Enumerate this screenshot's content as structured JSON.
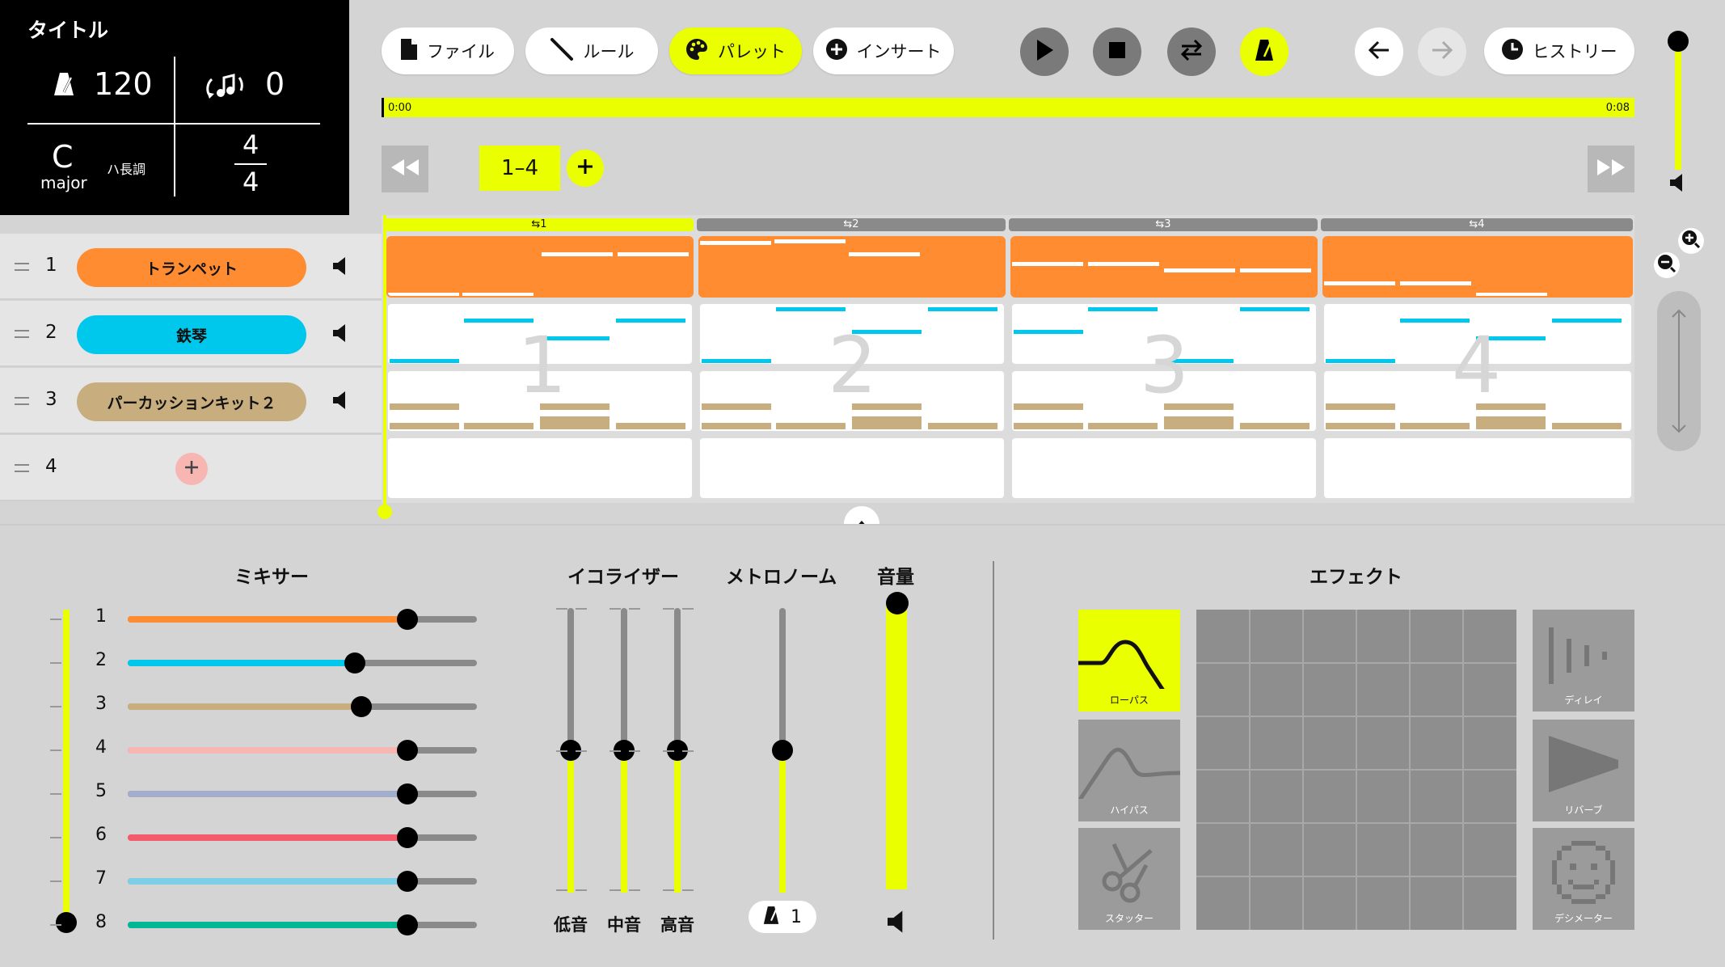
{
  "info": {
    "title": "タイトル",
    "tempo": "120",
    "transpose": "0",
    "key": "C",
    "mode": "major",
    "key_jp": "ハ長調",
    "time_sig_top": "4",
    "time_sig_bottom": "4"
  },
  "toolbar": {
    "file": "ファイル",
    "rule": "ルール",
    "palette": "パレット",
    "insert": "インサート",
    "history": "ヒストリー"
  },
  "timeline": {
    "start": "0:00",
    "end": "0:08",
    "range": "1–4"
  },
  "measures": [
    "1",
    "2",
    "3",
    "4"
  ],
  "measure_headers": [
    "⇆1",
    "⇆2",
    "⇆3",
    "⇆4"
  ],
  "tracks": [
    {
      "no": "1",
      "name": "トランペット",
      "color": "#ff8c31"
    },
    {
      "no": "2",
      "name": "鉄琴",
      "color": "#00c8ec"
    },
    {
      "no": "3",
      "name": "パーカッションキット２",
      "color": "#c8ad7f"
    },
    {
      "no": "4"
    }
  ],
  "panels": {
    "mixer": "ミキサー",
    "equalizer": "イコライザー",
    "metronome": "メトロノーム",
    "volume": "音量",
    "effect": "エフェクト"
  },
  "mixer": [
    {
      "no": "1",
      "color": "#ff8c31",
      "level": 0.8
    },
    {
      "no": "2",
      "color": "#00c8ec",
      "level": 0.65
    },
    {
      "no": "3",
      "color": "#c8ad7f",
      "level": 0.67
    },
    {
      "no": "4",
      "color": "#f7b6b1",
      "level": 0.8
    },
    {
      "no": "5",
      "color": "#a3aecd",
      "level": 0.8
    },
    {
      "no": "6",
      "color": "#f45a6c",
      "level": 0.8
    },
    {
      "no": "7",
      "color": "#7ccfe6",
      "level": 0.8
    },
    {
      "no": "8",
      "color": "#00b894",
      "level": 0.8
    }
  ],
  "equalizer": {
    "low": "低音",
    "mid": "中音",
    "high": "高音"
  },
  "metronome_beat": "1",
  "effects": {
    "lowpass": "ローパス",
    "highpass": "ハイパス",
    "stutter": "スタッター",
    "delay": "ディレイ",
    "reverb": "リバーブ",
    "decimator": "デシメーター"
  },
  "colors": {
    "accent": "#eaff00",
    "panel": "#d4d4d4"
  }
}
